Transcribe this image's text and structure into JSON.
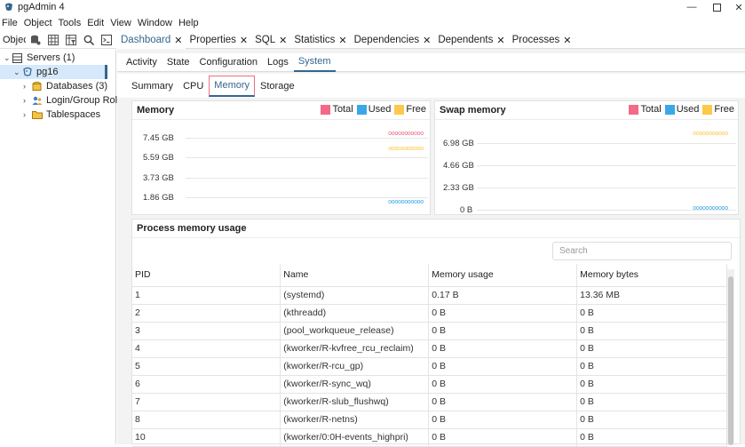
{
  "window": {
    "title": "pgAdmin 4"
  },
  "menu": [
    "File",
    "Object",
    "Tools",
    "Edit",
    "View",
    "Window",
    "Help"
  ],
  "left_toolbar": {
    "label": "Objec"
  },
  "tree": {
    "servers": "Servers (1)",
    "server": "pg16",
    "databases": "Databases (3)",
    "roles": "Login/Group Roles",
    "tablespaces": "Tablespaces"
  },
  "top_tabs": [
    "Dashboard",
    "Properties",
    "SQL",
    "Statistics",
    "Dependencies",
    "Dependents",
    "Processes"
  ],
  "sub_tabs": [
    "Activity",
    "State",
    "Configuration",
    "Logs",
    "System"
  ],
  "third_tabs": [
    "Summary",
    "CPU",
    "Memory",
    "Storage"
  ],
  "memory_chart": {
    "title": "Memory",
    "legend": [
      "Total",
      "Used",
      "Free"
    ],
    "ticks": [
      "7.45 GB",
      "5.59 GB",
      "3.73 GB",
      "1.86 GB"
    ],
    "markers": "ooooooooooo"
  },
  "swap_chart": {
    "title": "Swap memory",
    "legend": [
      "Total",
      "Used",
      "Free"
    ],
    "ticks": [
      "6.98 GB",
      "4.66 GB",
      "2.33 GB",
      "0 B"
    ],
    "markers": "ooooooooooo"
  },
  "colors": {
    "total": "#f26a87",
    "used": "#3aa7e8",
    "free": "#fcc94a",
    "accent": "#326690"
  },
  "process_panel": {
    "title": "Process memory usage",
    "search_placeholder": "Search",
    "columns": [
      "PID",
      "Name",
      "Memory usage",
      "Memory bytes"
    ],
    "rows": [
      [
        "1",
        "(systemd)",
        "0.17 B",
        "13.36 MB"
      ],
      [
        "2",
        "(kthreadd)",
        "0 B",
        "0 B"
      ],
      [
        "3",
        "(pool_workqueue_release)",
        "0 B",
        "0 B"
      ],
      [
        "4",
        "(kworker/R-kvfree_rcu_reclaim)",
        "0 B",
        "0 B"
      ],
      [
        "5",
        "(kworker/R-rcu_gp)",
        "0 B",
        "0 B"
      ],
      [
        "6",
        "(kworker/R-sync_wq)",
        "0 B",
        "0 B"
      ],
      [
        "7",
        "(kworker/R-slub_flushwq)",
        "0 B",
        "0 B"
      ],
      [
        "8",
        "(kworker/R-netns)",
        "0 B",
        "0 B"
      ],
      [
        "10",
        "(kworker/0:0H-events_highpri)",
        "0 B",
        "0 B"
      ]
    ]
  }
}
